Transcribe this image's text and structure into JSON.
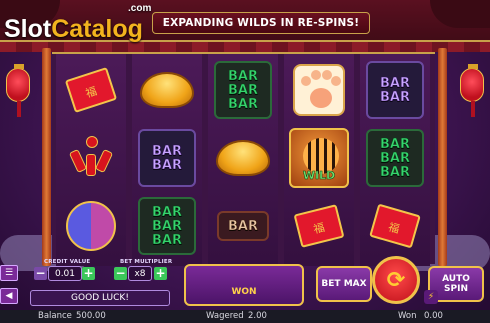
{
  "branding": {
    "logo_slot": "Slot",
    "logo_catalog": "Catalog",
    "logo_com": ".com"
  },
  "banner": {
    "text": "EXPANDING WILDS IN RE-SPINS!"
  },
  "reels": [
    [
      "red-envelope-icon",
      "firecracker-icon",
      "purple-fish-icon"
    ],
    [
      "gold-ingot-icon",
      "bar-double-purple-icon",
      "bar-triple-green-icon"
    ],
    [
      "bar-triple-green-icon",
      "gold-ingot-icon",
      "bar-single-icon"
    ],
    [
      "tiger-paw-icon",
      "tiger-wild-icon",
      "red-envelope-icon"
    ],
    [
      "bar-double-purple-icon",
      "bar-triple-green-icon",
      "red-envelope-icon"
    ]
  ],
  "symbols": {
    "bar": "BAR",
    "wild": "WILD",
    "envelope_char": "福"
  },
  "controls": {
    "credit_value_label": "CREDIT VALUE",
    "credit_value": "0.01",
    "bet_multiplier_label": "BET MULTIPLIER",
    "bet_multiplier": "x8",
    "minus": "−",
    "plus": "+",
    "message": "GOOD LUCK!",
    "win_label": "WON",
    "bet_max_label": "BET MAX",
    "auto_spin_label": "AUTO SPIN",
    "spin_glyph": "⟳",
    "menu_glyph": "☰",
    "sound_glyph": "◀",
    "turbo_glyph": "⚡"
  },
  "status": {
    "balance_label": "Balance",
    "balance_value": "500.00",
    "wagered_label": "Wagered",
    "wagered_value": "2.00",
    "won_label": "Won",
    "won_value": "0.00"
  },
  "colors": {
    "accent_gold": "#f0c24a",
    "spin_red": "#c0101a",
    "bar_green": "#36d56e"
  }
}
